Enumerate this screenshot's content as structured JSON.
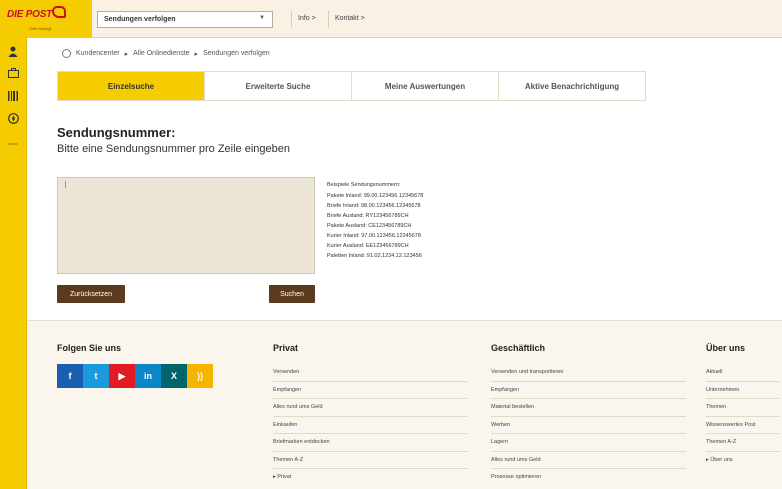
{
  "header": {
    "brand": "DIE POST",
    "tagline": "Gelb bewegt",
    "select_value": "Sendungen verfolgen",
    "info_label": "Info >",
    "kontakt_label": "Kontakt >"
  },
  "breadcrumb": {
    "items": [
      "Kundencenter",
      "Alle Onlinedienste",
      "Sendungen verfolgen"
    ],
    "separator": "▸"
  },
  "tabs": [
    {
      "label": "Einzelsuche",
      "active": true
    },
    {
      "label": "Erweiterte Suche",
      "active": false
    },
    {
      "label": "Meine Auswertungen",
      "active": false
    },
    {
      "label": "Aktive Benachrichtigung",
      "active": false
    }
  ],
  "form": {
    "title": "Sendungsnummer:",
    "subtitle": "Bitte eine Sendungsnummer pro Zeile eingeben",
    "textarea_value": "|",
    "reset_label": "Zurücksetzen",
    "search_label": "Suchen"
  },
  "examples": {
    "heading": "Beispiele Sendungsnummern:",
    "items": [
      "Pakete Inland: 99.00.123456.12345678",
      "Briefe Inland: 98.00.123456.12345678",
      "Briefe Ausland: RY123456789CH",
      "Pakete Ausland: CE123456789CH",
      "Kurier Inland: 97.00.123456.12345678",
      "Kurier Ausland: EE123456789CH",
      "Paletten Inland: 91.02.1234.12.123456"
    ]
  },
  "footer": {
    "follow_heading": "Folgen Sie uns",
    "social": [
      {
        "label": "f",
        "color": "#1a5eb0",
        "icon": "facebook-icon"
      },
      {
        "label": "t",
        "color": "#1a9be0",
        "icon": "twitter-icon"
      },
      {
        "label": "▶",
        "color": "#e21a24",
        "icon": "youtube-icon"
      },
      {
        "label": "in",
        "color": "#0b86c6",
        "icon": "linkedin-icon"
      },
      {
        "label": "X",
        "color": "#00646c",
        "icon": "xing-icon"
      },
      {
        "label": "))",
        "color": "#f5b500",
        "icon": "rss-icon"
      }
    ],
    "columns": [
      {
        "heading": "Privat",
        "items": [
          "Versenden",
          "Empfangen",
          "Alles rund ums Geld",
          "Einkaufen",
          "Briefmarken entdecken",
          "Themen A-Z",
          "▸ Privat"
        ]
      },
      {
        "heading": "Geschäftlich",
        "items": [
          "Versenden und transportieren",
          "Empfangen",
          "Material bestellen",
          "Werben",
          "Lagern",
          "Alles rund ums Geld",
          "Prozesse optimieren"
        ]
      },
      {
        "heading": "Über uns",
        "items": [
          "Aktuell",
          "Unternehmen",
          "Themen",
          "Wissenswertes Post",
          "Themen A-Z",
          "▸ Über uns"
        ]
      }
    ]
  },
  "colors": {
    "accent": "#f5cc00",
    "button": "#5c3a1e",
    "brand_red": "#c8102e"
  }
}
